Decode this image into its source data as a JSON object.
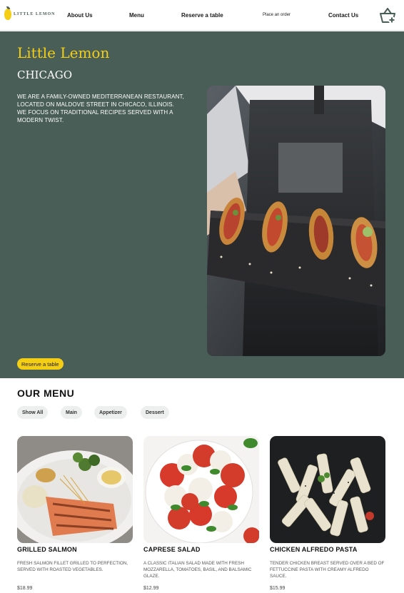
{
  "nav": {
    "logo_text": "LITTLE LEMON",
    "about": "About Us",
    "menu": "Menu",
    "reserve": "Reserve a table",
    "order": "Place an order",
    "contact": "Contact Us",
    "basket_icon": "basket-plus-icon"
  },
  "hero": {
    "title": "Little Lemon",
    "subtitle": "CHICAGO",
    "description": "We are a family-owned Mediterranean restaurant, located on Maldove Street in Chicaco, Illinois. We focus on traditional recipes served with a modern twist.",
    "button": "Reserve a table"
  },
  "menu": {
    "title": "OUR MENU",
    "filters": [
      "Show All",
      "Main",
      "Appetizer",
      "Dessert"
    ],
    "items": [
      {
        "name": "GRILLED SALMON",
        "description": "Fresh salmon fillet grilled to perfection, served with roasted vegetables.",
        "price": "$18.99"
      },
      {
        "name": "CAPRESE SALAD",
        "description": "A classic Italian salad made with fresh mozzarella, tomatoes, basil, and balsamic glaze.",
        "price": "$12.99"
      },
      {
        "name": "CHICKEN ALFREDO PASTA",
        "description": "Tender chicken breast served over a bed of fettuccine pasta with creamy Alfredo sauce.",
        "price": "$15.99"
      }
    ]
  },
  "colors": {
    "primary_green": "#495e57",
    "primary_yellow": "#f4ce14",
    "chip_bg": "#edefee"
  }
}
